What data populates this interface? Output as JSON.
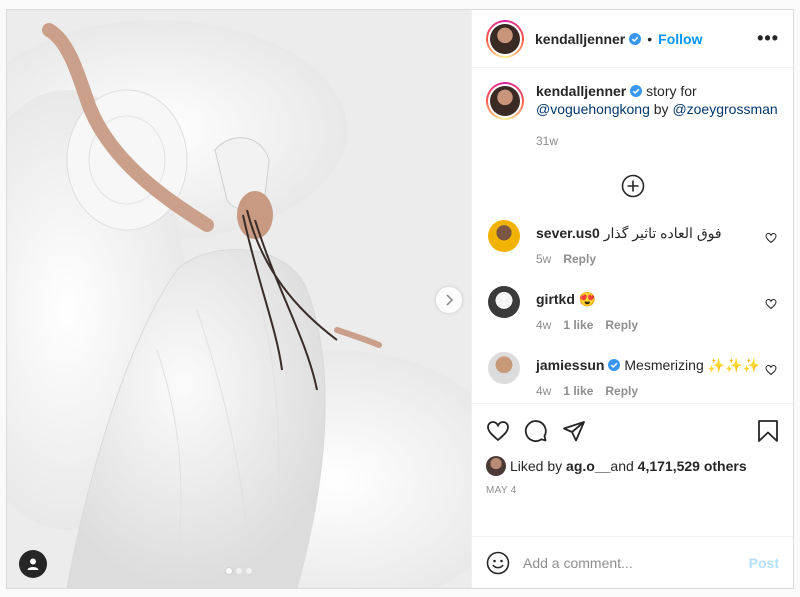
{
  "post": {
    "username": "kendalljenner",
    "separator": "•",
    "follow_label": "Follow",
    "more_label": "•••",
    "caption": {
      "username": "kendalljenner",
      "text_pre": " story for ",
      "mention_1": "@voguehongkong",
      "text_mid": " by ",
      "mention_2": "@zoeygrossman",
      "time": "31w"
    },
    "comments": [
      {
        "username": "sever.us0",
        "text": "فوق العاده تاثیر گذار",
        "time": "5w",
        "likes": "",
        "reply": "Reply"
      },
      {
        "username": "girtkd",
        "text": "😍",
        "time": "4w",
        "likes": "1 like",
        "reply": "Reply"
      },
      {
        "username": "jamiessun",
        "text": "Mesmerizing ✨✨✨",
        "time": "4w",
        "likes": "1 like",
        "reply": "Reply"
      }
    ],
    "likes": {
      "prefix": "Liked by ",
      "user": "ag.o__",
      "middle": " and ",
      "count": "4,171,529 others"
    },
    "date": "MAY 4",
    "add_comment_placeholder": "Add a comment...",
    "post_button": "Post"
  },
  "media": {
    "carousel_total": 3,
    "carousel_active": 1
  },
  "icons": {
    "verified": "verified-badge-icon",
    "like": "heart-icon",
    "comment": "comment-bubble-icon",
    "share": "paper-plane-icon",
    "save": "bookmark-icon",
    "load_more": "plus-circle-icon",
    "emoji": "smiley-icon",
    "next": "chevron-right-icon",
    "tag": "user-tag-icon"
  },
  "colors": {
    "accent": "#0095f6",
    "post_disabled": "#b2dffc",
    "muted": "#8e8e8e",
    "verified": "#3897f0"
  }
}
